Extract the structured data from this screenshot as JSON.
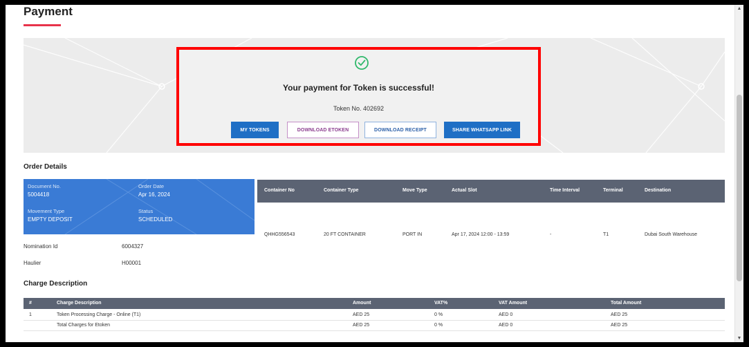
{
  "page": {
    "title": "Payment"
  },
  "confirmation": {
    "message": "Your payment for Token is successful!",
    "token_text": "Token No. 402692",
    "buttons": {
      "my_tokens": "MY TOKENS",
      "download_etoken": "DOWNLOAD ETOKEN",
      "download_receipt": "DOWNLOAD RECEIPT",
      "share_whatsapp": "SHARE WHATSAPP LINK"
    },
    "colors": {
      "primary": "#1f6fc5",
      "highlight_border": "#ff0000",
      "success_icon": "#2fb86b"
    },
    "icon": "check-circle-icon"
  },
  "order_details": {
    "title": "Order Details",
    "document_no_label": "Document No.",
    "document_no": "5004418",
    "order_date_label": "Order Date",
    "order_date": "Apr 16, 2024",
    "movement_type_label": "Movement Type",
    "movement_type": "EMPTY DEPOSIT",
    "status_label": "Status",
    "status": "SCHEDULED",
    "nomination_label": "Nomination Id",
    "nomination_id": "6004327",
    "haulier_label": "Haulier",
    "haulier": "H00001"
  },
  "container_table": {
    "headers": [
      "Container No",
      "Container Type",
      "Move Type",
      "Actual Slot",
      "Time Interval",
      "Terminal",
      "Destination"
    ],
    "rows": [
      [
        "QHHG556543",
        "20 FT CONTAINER",
        "PORT IN",
        "Apr 17, 2024 12:00 - 13:59",
        "-",
        "T1",
        "Dubai South Warehouse"
      ]
    ]
  },
  "charges": {
    "title": "Charge Description",
    "headers": [
      "#",
      "Charge Description",
      "Amount",
      "VAT%",
      "VAT Amount",
      "Total Amount"
    ],
    "rows": [
      [
        "1",
        "Token Processing Charge - Online (T1)",
        "AED 25",
        "0 %",
        "AED 0",
        "AED 25"
      ],
      [
        "",
        "Total Charges for Etoken",
        "AED 25",
        "0 %",
        "AED 0",
        "AED 25"
      ]
    ]
  }
}
